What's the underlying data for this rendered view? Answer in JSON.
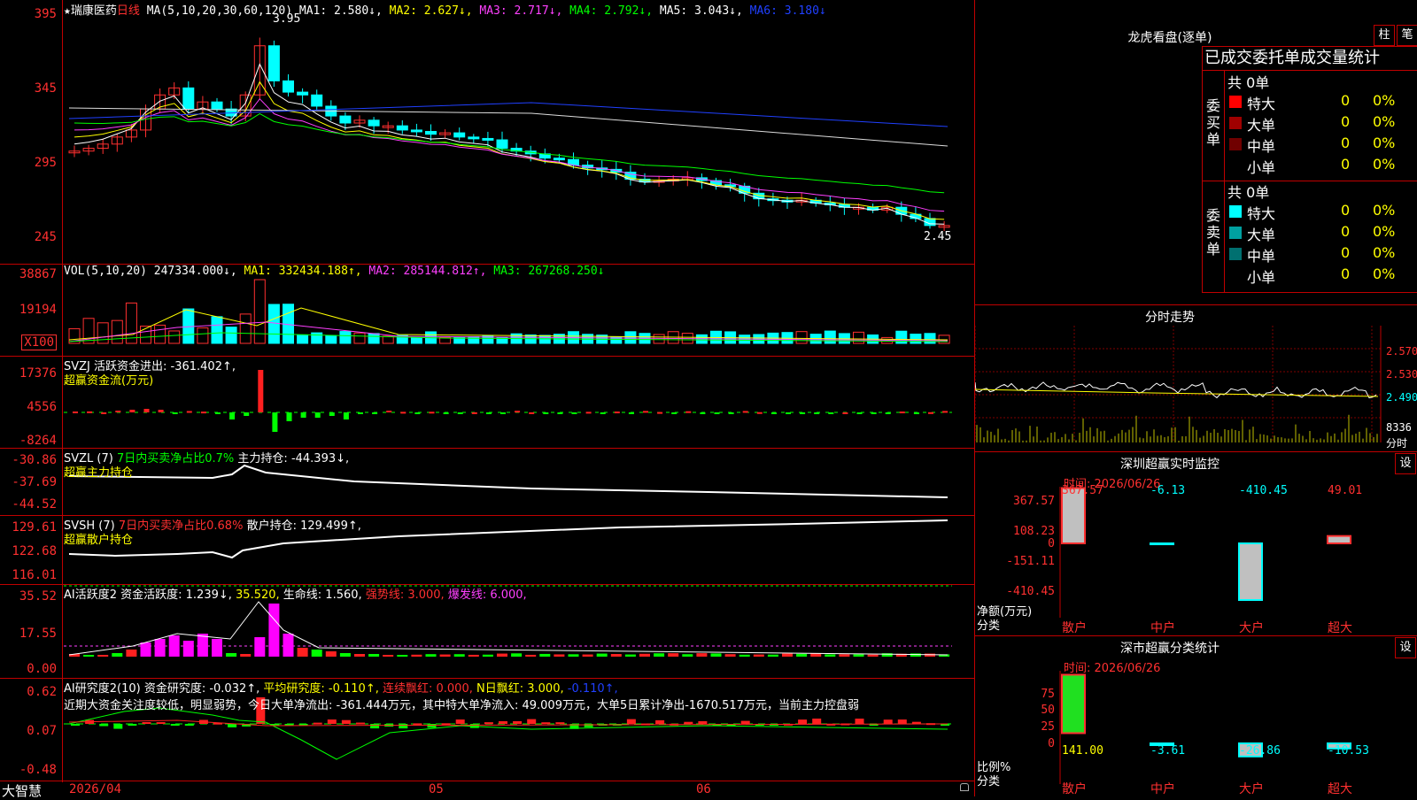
{
  "stock": {
    "name": "瑞康医药",
    "period": "日线",
    "ma_header": "MA(5,10,20,30,60,120)",
    "ma": [
      {
        "label": "MA1: 2.580↓,",
        "color": "#ffffff"
      },
      {
        "label": "MA2: 2.627↓,",
        "color": "#ffff00"
      },
      {
        "label": "MA3: 2.717↓,",
        "color": "#ff40ff"
      },
      {
        "label": "MA4: 2.792↓,",
        "color": "#00ff00"
      },
      {
        "label": "MA5: 3.043↓,",
        "color": "#ffffff"
      },
      {
        "label": "MA6: 3.180↓",
        "color": "#2040ff"
      }
    ],
    "high_mark": "3.95",
    "low_mark": "2.45",
    "price_axis": [
      "395",
      "345",
      "295",
      "245"
    ]
  },
  "vol": {
    "header": "VOL(5,10,20)",
    "value": "247334.000↓,",
    "ma1": "MA1: 332434.188↑,",
    "ma2": "MA2: 285144.812↑,",
    "ma3": "MA3: 267268.250↓",
    "axis": [
      "38867",
      "19194"
    ],
    "unit": "X100"
  },
  "svzj": {
    "header": "SVZJ  活跃资金进出: -361.402↑,",
    "sub": "超赢资金流(万元)",
    "axis": [
      "17376",
      "4556",
      "-8264"
    ]
  },
  "svzl": {
    "header": "SVZL (7) ",
    "green": "7日内买卖净占比0.7%",
    "rest": " 主力持仓: -44.393↓,",
    "sub": "超赢主力持仓",
    "axis": [
      "-30.86",
      "-37.69",
      "-44.52"
    ]
  },
  "svsh": {
    "header": "SVSH (7) ",
    "red": "7日内买卖净占比0.68%",
    "rest": " 散户持仓: 129.499↑,",
    "sub": "超赢散户持仓",
    "axis": [
      "129.61",
      "122.68",
      "116.01"
    ]
  },
  "ai2": {
    "header": "AI活跃度2 资金活跃度: 1.239↓,",
    "v2": "35.520,",
    "v3": "生命线: 1.560,",
    "v4": "强势线: 3.000,",
    "v5": "爆发线: 6.000,",
    "axis": [
      "35.52",
      "17.55",
      "0.00"
    ]
  },
  "ai_res": {
    "header": "AI研究度2(10) 资金研究度: -0.032↑,",
    "v2": "平均研究度: -0.110↑,",
    "v3": "连续飘红: 0.000,",
    "v4": "N日飘红: 3.000,",
    "v5": "-0.110↑,",
    "text": "近期大资金关注度较低，明显弱势，今日大单净流出: -361.444万元，其中特大单净流入: 49.009万元，大单5日累计净出-1670.517万元，当前主力控盘弱",
    "axis": [
      "0.62",
      "0.07",
      "-0.48"
    ]
  },
  "bottom": {
    "brand": "大智慧",
    "dates": [
      "2026/04",
      "05",
      "06"
    ]
  },
  "longhu": {
    "title": "龙虎看盘(逐单)",
    "btn1": "柱",
    "btn2": "笔",
    "subtitle": "已成交委托单成交量统计",
    "buy": {
      "label": "委买单",
      "total": "共 0单",
      "rows": [
        {
          "name": "特大",
          "count": "0",
          "pct": "0%",
          "color": "#ff0000"
        },
        {
          "name": "大单",
          "count": "0",
          "pct": "0%",
          "color": "#a00000"
        },
        {
          "name": "中单",
          "count": "0",
          "pct": "0%",
          "color": "#700000"
        },
        {
          "name": "小单",
          "count": "0",
          "pct": "0%",
          "color": ""
        }
      ]
    },
    "sell": {
      "label": "委卖单",
      "total": "共 0单",
      "rows": [
        {
          "name": "特大",
          "count": "0",
          "pct": "0%",
          "color": "#00ffff"
        },
        {
          "name": "大单",
          "count": "0",
          "pct": "0%",
          "color": "#00a0a0"
        },
        {
          "name": "中单",
          "count": "0",
          "pct": "0%",
          "color": "#007070"
        },
        {
          "name": "小单",
          "count": "0",
          "pct": "0%",
          "color": ""
        }
      ]
    }
  },
  "fenshi": {
    "title": "分时走势",
    "axis": [
      "2.570",
      "2.530",
      "2.490"
    ],
    "vol_value": "8336",
    "vol_unit": "分时"
  },
  "monitor": {
    "title": "深圳超赢实时监控",
    "btn": "设",
    "time": "时间: 2026/06/26",
    "axis": [
      "367.57",
      "108.23",
      "0",
      "-151.11",
      "-410.45"
    ],
    "unit": "净额(万元)",
    "cat_label": "分类",
    "categories": [
      "散户",
      "中户",
      "大户",
      "超大"
    ],
    "values": [
      "367.57",
      "-6.13",
      "-410.45",
      "49.01"
    ]
  },
  "stats": {
    "title": "深市超赢分类统计",
    "btn": "设",
    "time": "时间: 2026/06/26",
    "axis": [
      "75",
      "50",
      "25",
      "0"
    ],
    "unit": "比例%",
    "cat_label": "分类",
    "categories": [
      "散户",
      "中户",
      "大户",
      "超大"
    ],
    "values": [
      "141.00",
      "-3.61",
      "-26.86",
      "-10.53"
    ]
  }
}
